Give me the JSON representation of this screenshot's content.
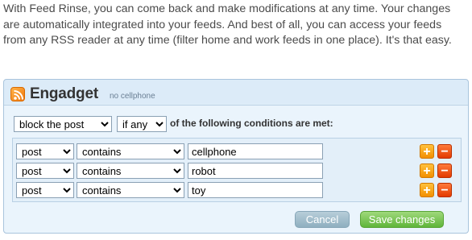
{
  "intro": {
    "text": "With Feed Rinse, you can come back and make modifications at any time. Your changes are automatically integrated into your feeds. And best of all, you can access your feeds from any RSS reader at any time (filter home and work feeds in one place). It's that easy."
  },
  "feed": {
    "title": "Engadget",
    "subtitle": "no cellphone",
    "icon": "rss-icon"
  },
  "rule": {
    "action": "block the post",
    "match": "if any",
    "match_label": "of the following conditions are met:"
  },
  "conditions": [
    {
      "field": "post",
      "operator": "contains",
      "value": "cellphone"
    },
    {
      "field": "post",
      "operator": "contains",
      "value": "robot"
    },
    {
      "field": "post",
      "operator": "contains",
      "value": "toy"
    }
  ],
  "buttons": {
    "add_label": "+",
    "remove_label": "−",
    "cancel": "Cancel",
    "save": "Save changes"
  },
  "colors": {
    "panel_bg": "#eaf4fc",
    "add": "#f5a000",
    "remove": "#f04a00",
    "save": "#6cbf45",
    "cancel": "#9fbccb"
  }
}
